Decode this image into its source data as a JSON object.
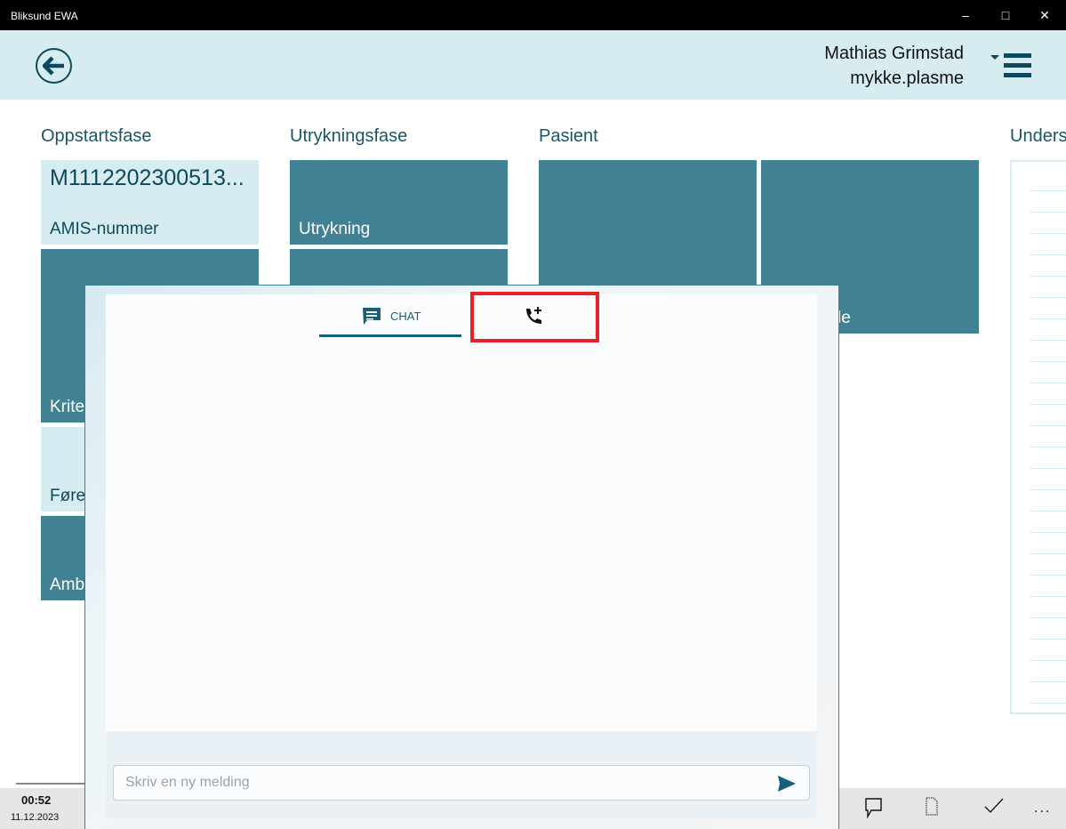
{
  "window": {
    "title": "Bliksund EWA",
    "controls": [
      "minimize",
      "maximize",
      "close"
    ]
  },
  "header": {
    "user_name": "Mathias Grimstad",
    "username": "mykke.plasme",
    "icons": [
      "back-arrow-icon",
      "menu-icon"
    ]
  },
  "columns": [
    {
      "title": "Oppstartsfase",
      "tiles": [
        {
          "value": "M1112202300513...",
          "label": "AMIS-nummer"
        },
        {
          "label": "Krite"
        },
        {
          "label": "Føre"
        },
        {
          "label": "Amb"
        }
      ]
    },
    {
      "title": "Utrykningsfase",
      "tiles": [
        {
          "label": "Utrykning"
        },
        {
          "label": ""
        }
      ]
    },
    {
      "title": "Pasient",
      "tiles": [
        {
          "label": ""
        },
        {
          "label": "le"
        }
      ]
    },
    {
      "title": "Unders"
    }
  ],
  "dialog": {
    "tabs": [
      {
        "label": "CHAT",
        "icon": "chat-icon",
        "active": true
      },
      {
        "label": "",
        "icon": "phone-add-icon",
        "highlighted": true
      }
    ],
    "message_placeholder": "Skriv en ny melding",
    "send_icon": "send-icon"
  },
  "statusbar": {
    "time": "00:52",
    "date": "11.12.2023",
    "icons": [
      "comment-icon",
      "document-icon",
      "check-icon",
      "more-icon"
    ],
    "more": "..."
  },
  "colors": {
    "teal": "#418194",
    "light": "#d7ecf1",
    "dark": "#0b4a5c",
    "highlight": "#e8202a"
  }
}
